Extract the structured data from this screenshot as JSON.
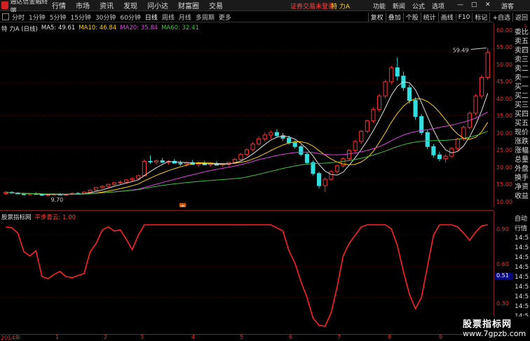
{
  "menubar": {
    "app_title": "通达信金融终端",
    "items": [
      "行情",
      "市场",
      "资讯",
      "发现",
      "问小达",
      "财富圈",
      "交易"
    ],
    "notice": "证券交易未登录",
    "stock": "特 力A",
    "right_items": [
      "功能",
      "新闻",
      "公式",
      "选项"
    ],
    "guest": "游客"
  },
  "toolbar": {
    "periods": [
      "分时",
      "1分钟",
      "5分钟",
      "15分钟",
      "30分钟",
      "60分钟",
      "日线",
      "周线",
      "月线",
      "多周期",
      "更多"
    ],
    "active_period": "日线",
    "right_buttons": [
      "复权",
      "叠加",
      "个股",
      "统计",
      "画线",
      "F10",
      "标记",
      "+自选",
      "返回"
    ]
  },
  "main_legend": {
    "title": "特 力A (日线)",
    "ma5": "MA5: 49.61",
    "ma10": "MA10: 46.84",
    "ma20": "MA20: 35.84",
    "ma60": "MA60: 32.41"
  },
  "price_axis": {
    "ticks": [
      "60.00",
      "55.00",
      "50.00",
      "45.00",
      "40.00",
      "35.00",
      "30.00",
      "25.00",
      "20.00",
      "15.00",
      "10.00"
    ],
    "high_label": "59.49",
    "low_label": "9.70",
    "marker": "定"
  },
  "right_panel": {
    "corner": "L",
    "items": [
      "委比",
      "卖五",
      "卖四",
      "卖三",
      "卖二",
      "卖一",
      "买一",
      "买二",
      "买三",
      "买四",
      "买五",
      "现价",
      "涨跌",
      "涨幅",
      "总量",
      "外盘",
      "换手",
      "净资",
      "收益"
    ]
  },
  "sub_chart": {
    "name": "股票指标网",
    "series": "平步青云: 1.00",
    "ticks": [
      "0.90",
      "0.60",
      "0.30"
    ],
    "current": "0.51",
    "right_items": [
      "自动",
      "行情",
      "14:5",
      "14:5",
      "14:5",
      "14:5",
      "14:5",
      "14:5",
      "14:5",
      "14:5",
      "14:5",
      "14:5",
      "14:5"
    ]
  },
  "time_axis": {
    "labels": [
      "2014年",
      "1",
      "2",
      "3",
      "4",
      "5",
      "6",
      "7",
      "8",
      "9"
    ]
  },
  "watermark": {
    "title": "股票指标网",
    "url": "www.7gpzb.com"
  },
  "colors": {
    "up": "#ff3030",
    "down": "#30e0e0",
    "ma5": "#e0e0e0",
    "ma10": "#ffd200",
    "ma20": "#e040e0",
    "ma60": "#40c040",
    "indicator": "#ff2020"
  },
  "chart_data": {
    "type": "candlestick",
    "title": "特 力A (日线)",
    "ylim": [
      8,
      62
    ],
    "indicator_ylim": [
      0,
      1
    ],
    "candles": [
      [
        10.5,
        11.2,
        10.1,
        10.9
      ],
      [
        10.9,
        11.3,
        10.5,
        10.7
      ],
      [
        10.7,
        11.0,
        10.3,
        10.4
      ],
      [
        10.4,
        10.8,
        10.0,
        10.2
      ],
      [
        10.2,
        10.6,
        9.9,
        10.5
      ],
      [
        10.5,
        10.9,
        10.2,
        10.3
      ],
      [
        10.3,
        10.6,
        9.8,
        10.0
      ],
      [
        10.0,
        10.4,
        9.7,
        10.2
      ],
      [
        10.2,
        10.6,
        9.9,
        10.4
      ],
      [
        10.4,
        10.7,
        10.0,
        10.1
      ],
      [
        10.1,
        10.5,
        9.9,
        10.3
      ],
      [
        10.3,
        10.8,
        10.1,
        10.6
      ],
      [
        10.6,
        11.0,
        10.3,
        10.5
      ],
      [
        10.5,
        11.2,
        10.4,
        11.0
      ],
      [
        11.0,
        11.8,
        10.8,
        11.6
      ],
      [
        11.6,
        12.6,
        11.4,
        12.4
      ],
      [
        12.4,
        13.2,
        12.0,
        12.8
      ],
      [
        12.8,
        13.6,
        12.5,
        13.4
      ],
      [
        13.4,
        14.2,
        13.0,
        13.9
      ],
      [
        13.9,
        14.6,
        13.4,
        14.1
      ],
      [
        14.1,
        15.0,
        13.8,
        14.8
      ],
      [
        14.8,
        15.6,
        14.3,
        15.2
      ],
      [
        15.2,
        16.4,
        14.9,
        16.1
      ],
      [
        16.1,
        21.2,
        15.9,
        20.6
      ],
      [
        20.6,
        22.4,
        19.8,
        20.4
      ],
      [
        20.4,
        21.2,
        19.6,
        20.8
      ],
      [
        20.8,
        21.6,
        20.0,
        20.3
      ],
      [
        20.3,
        21.0,
        19.5,
        20.6
      ],
      [
        20.6,
        21.3,
        19.9,
        20.0
      ],
      [
        20.0,
        20.8,
        19.2,
        19.8
      ],
      [
        19.8,
        20.6,
        19.0,
        20.2
      ],
      [
        20.2,
        21.0,
        19.5,
        19.6
      ],
      [
        19.6,
        20.4,
        18.8,
        20.0
      ],
      [
        20.0,
        20.8,
        19.4,
        19.5
      ],
      [
        19.5,
        20.2,
        18.9,
        19.9
      ],
      [
        19.9,
        20.6,
        19.3,
        19.4
      ],
      [
        19.4,
        20.0,
        18.8,
        19.7
      ],
      [
        19.7,
        20.5,
        19.2,
        20.3
      ],
      [
        20.3,
        21.6,
        20.0,
        21.2
      ],
      [
        21.2,
        23.2,
        20.9,
        22.8
      ],
      [
        22.8,
        24.6,
        22.2,
        24.2
      ],
      [
        24.2,
        26.6,
        23.8,
        26.0
      ],
      [
        26.0,
        28.4,
        25.4,
        27.6
      ],
      [
        27.6,
        29.6,
        26.8,
        28.8
      ],
      [
        28.8,
        30.2,
        27.6,
        29.6
      ],
      [
        29.6,
        30.6,
        28.2,
        28.6
      ],
      [
        28.6,
        29.4,
        27.0,
        27.8
      ],
      [
        27.8,
        28.6,
        25.8,
        26.4
      ],
      [
        26.4,
        27.2,
        24.6,
        25.2
      ],
      [
        25.2,
        25.8,
        22.2,
        22.8
      ],
      [
        22.8,
        23.4,
        19.6,
        20.2
      ],
      [
        20.2,
        20.8,
        16.2,
        16.8
      ],
      [
        16.8,
        17.4,
        12.2,
        13.0
      ],
      [
        13.0,
        15.6,
        11.0,
        15.0
      ],
      [
        15.0,
        17.8,
        14.6,
        17.4
      ],
      [
        17.4,
        19.6,
        16.8,
        19.2
      ],
      [
        19.2,
        21.8,
        18.6,
        21.4
      ],
      [
        21.4,
        24.4,
        20.8,
        24.0
      ],
      [
        24.0,
        27.2,
        23.4,
        26.8
      ],
      [
        26.8,
        30.4,
        26.0,
        30.0
      ],
      [
        30.0,
        33.6,
        29.4,
        33.2
      ],
      [
        33.2,
        37.4,
        32.6,
        36.8
      ],
      [
        36.8,
        41.6,
        36.0,
        41.0
      ],
      [
        41.0,
        46.0,
        40.2,
        45.4
      ],
      [
        45.4,
        50.4,
        44.6,
        49.8
      ],
      [
        49.8,
        53.0,
        45.8,
        47.2
      ],
      [
        47.2,
        48.6,
        42.6,
        43.6
      ],
      [
        43.6,
        44.6,
        38.6,
        39.6
      ],
      [
        39.6,
        40.6,
        33.6,
        34.6
      ],
      [
        34.6,
        35.4,
        28.8,
        29.6
      ],
      [
        29.6,
        30.4,
        24.4,
        25.2
      ],
      [
        25.2,
        26.0,
        21.8,
        22.6
      ],
      [
        22.6,
        23.6,
        20.6,
        21.4
      ],
      [
        21.4,
        22.8,
        20.2,
        22.2
      ],
      [
        22.2,
        25.0,
        21.6,
        24.6
      ],
      [
        24.6,
        28.0,
        24.0,
        27.6
      ],
      [
        27.6,
        31.8,
        27.0,
        31.2
      ],
      [
        31.2,
        36.2,
        30.6,
        35.6
      ],
      [
        35.6,
        41.6,
        35.0,
        41.0
      ],
      [
        41.0,
        47.6,
        40.2,
        46.8
      ],
      [
        46.8,
        56.0,
        46.0,
        54.6
      ]
    ],
    "indicator": [
      0.98,
      0.97,
      0.92,
      0.74,
      0.7,
      0.75,
      0.5,
      0.48,
      0.52,
      0.55,
      0.5,
      0.49,
      0.51,
      0.53,
      0.74,
      0.82,
      0.95,
      0.98,
      0.94,
      0.95,
      0.86,
      0.76,
      0.9,
      1.0,
      1.0,
      1.0,
      1.0,
      1.0,
      1.0,
      1.0,
      1.0,
      1.0,
      1.0,
      1.0,
      1.0,
      1.0,
      1.0,
      1.0,
      1.0,
      1.0,
      1.0,
      1.0,
      1.0,
      1.0,
      1.0,
      0.97,
      0.94,
      0.75,
      0.63,
      0.45,
      0.3,
      0.1,
      0.03,
      0.02,
      0.15,
      0.4,
      0.7,
      0.82,
      0.9,
      0.98,
      1.0,
      1.0,
      1.0,
      1.0,
      0.96,
      0.8,
      0.55,
      0.33,
      0.19,
      0.3,
      0.6,
      0.9,
      1.0,
      1.0,
      1.0,
      0.98,
      0.92,
      0.85,
      0.93,
      0.99,
      1.0
    ]
  }
}
